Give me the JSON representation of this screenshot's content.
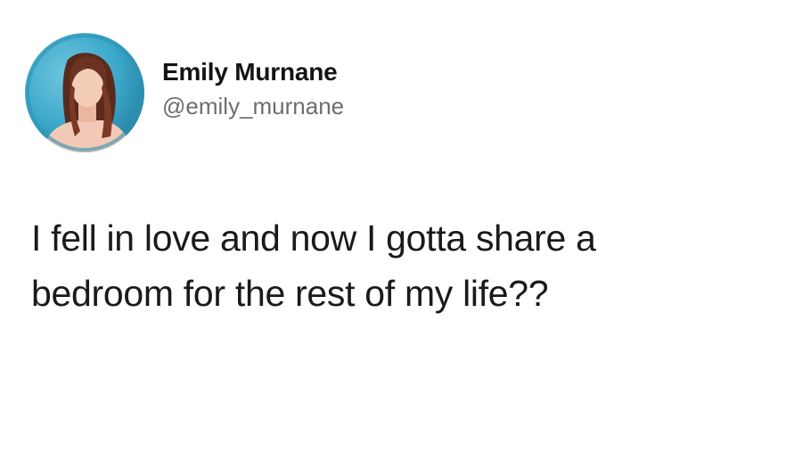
{
  "author": {
    "display_name": "Emily Murnane",
    "handle": "@emily_murnane",
    "avatar_icon": "profile-photo-avatar"
  },
  "tweet": {
    "lines": [
      "I fell in love and now I gotta share a",
      "bedroom for the rest of my life??"
    ]
  },
  "colors": {
    "background": "#ffffff",
    "text": "#1a1a1a",
    "handle": "#6b6f73",
    "avatar_bg": "#3aa6c8"
  }
}
